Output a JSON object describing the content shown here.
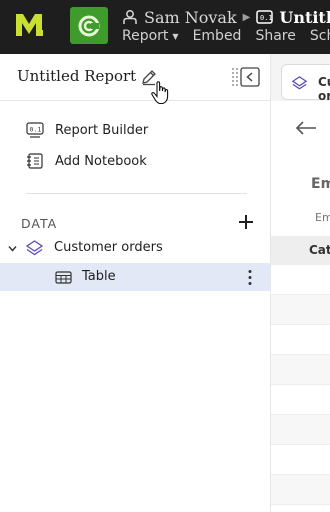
{
  "topbar": {
    "user_name": "Sam Novak",
    "report_title": "Untitled Report",
    "menu": [
      {
        "label": "Report",
        "has_caret": true
      },
      {
        "label": "Embed",
        "has_caret": false
      },
      {
        "label": "Share",
        "has_caret": false
      },
      {
        "label": "Schedule",
        "has_caret": false
      }
    ],
    "colors": {
      "background": "#1e1e1e",
      "logo": "#c9e033",
      "app_badge": "#3f9b2b"
    }
  },
  "left_panel": {
    "title": "Untitled Report",
    "nav": [
      {
        "label": "Report Builder",
        "icon": "report-builder-icon"
      },
      {
        "label": "Add Notebook",
        "icon": "notebook-icon"
      }
    ],
    "section_title": "DATA",
    "data_sources": [
      {
        "label": "Customer orders",
        "icon": "dataset-icon",
        "expanded": true,
        "children": [
          {
            "label": "Table",
            "icon": "table-icon",
            "selected": true
          }
        ]
      }
    ],
    "colors": {
      "selected_row": "#e2e8f6",
      "dataset_icon": "#5b4bb7"
    }
  },
  "right_panel": {
    "tab_label": "Customer orders",
    "heading": "Empty",
    "sub": "Empty",
    "column_header": "Category"
  }
}
